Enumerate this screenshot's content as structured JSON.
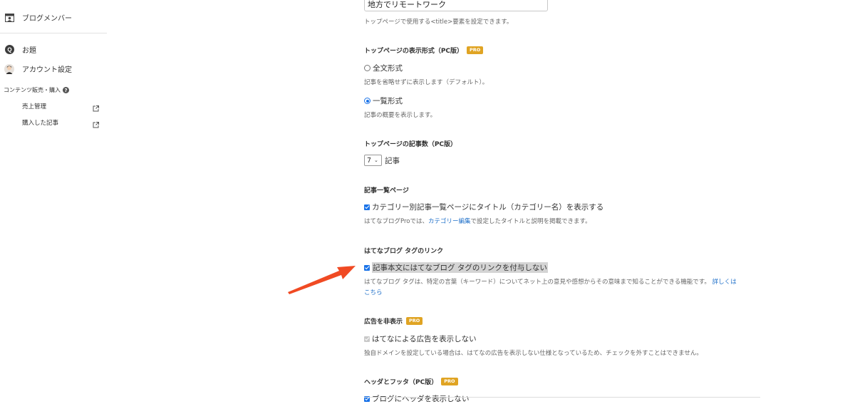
{
  "sidebar": {
    "items": [
      {
        "label": "ブログメンバー",
        "icon": "members-icon"
      },
      {
        "label": "お題",
        "icon": "odai-icon"
      },
      {
        "label": "アカウント設定",
        "icon": "avatar"
      }
    ],
    "content_sales_heading": "コンテンツ販売・購入",
    "sub_items": [
      {
        "label": "売上管理"
      },
      {
        "label": "購入した記事"
      }
    ]
  },
  "settings": {
    "title_value": "地方でリモートワーク",
    "title_help": "トップページで使用する<title>要素を設定できます。",
    "pro_badge": "PRO",
    "display_format": {
      "title": "トップページの表示形式（PC版）",
      "options": [
        {
          "label": "全文形式",
          "help": "記事を省略せずに表示します（デフォルト）。",
          "selected": false
        },
        {
          "label": "一覧形式",
          "help": "記事の概要を表示します。",
          "selected": true
        }
      ]
    },
    "post_count": {
      "title": "トップページの記事数（PC版）",
      "value": "7",
      "unit": "記事"
    },
    "archive": {
      "title": "記事一覧ページ",
      "checkbox_label": "カテゴリー別記事一覧ページにタイトル（カテゴリー名）を表示する",
      "help_before": "はてなブログProでは、",
      "help_link": "カテゴリー編集",
      "help_after": "で設定したタイトルと説明を掲載できます。"
    },
    "tag_link": {
      "title": "はてなブログ タグのリンク",
      "checkbox_label": "記事本文にはてなブログ タグのリンクを付与しない",
      "help": "はてなブログ タグは、特定の言葉（キーワード）についてネット上の意見や感想からその意味まで知ることができる機能です。",
      "help_link_1": "詳しくは",
      "help_link_2": "こちら"
    },
    "ads": {
      "title": "広告を非表示",
      "checkbox_label": "はてなによる広告を表示しない",
      "help": "独自ドメインを設定している場合は、はてなの広告を表示しない仕様となっているため、チェックを外すことはできません。"
    },
    "header_footer": {
      "title": "ヘッダとフッタ（PC版）",
      "checkbox_label": "ブログにヘッダを表示しない"
    }
  },
  "colors": {
    "accent": "#1a73e8",
    "pro": "#e0a423",
    "arrow": "#f04a23",
    "link": "#1e6fc9"
  }
}
